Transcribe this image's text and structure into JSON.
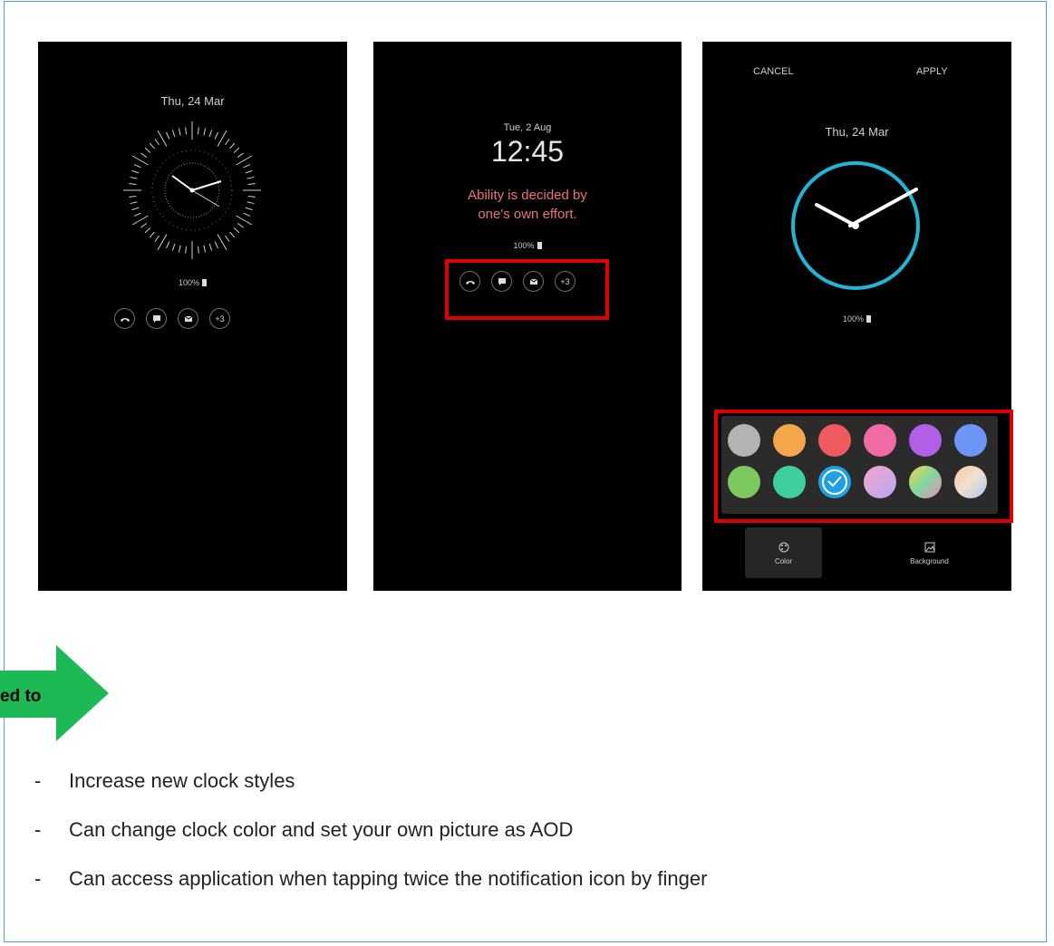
{
  "phone1": {
    "date": "Thu, 24 Mar",
    "battery": "100%",
    "notifications": [
      "missed-call-icon",
      "message-icon",
      "email-icon",
      "+3"
    ]
  },
  "phone2": {
    "date": "Tue, 2 Aug",
    "time": "12:45",
    "quote_line1": "Ability is decided by",
    "quote_line2": "one's own effort.",
    "battery": "100%",
    "notifications": [
      "missed-call-icon",
      "message-icon",
      "email-icon",
      "+3"
    ]
  },
  "phone3": {
    "cancel": "CANCEL",
    "apply": "APPLY",
    "date": "Thu, 24 Mar",
    "battery": "100%",
    "clock_color": "#1fb7d6",
    "swatches": [
      "#b3b3b3",
      "#f4a64a",
      "#ef5a5f",
      "#f06aa3",
      "#b05fe6",
      "#6c95f5",
      "#7dc95e",
      "#3fcf9f",
      "#1fa0e6",
      "gradient-pink",
      "gradient-yellow",
      "gradient-peach"
    ],
    "selected_swatch": 8,
    "tab_color": "Color",
    "tab_background": "Background"
  },
  "arrow": {
    "label": "ed to",
    "color": "#1db954"
  },
  "bullets": [
    "Increase new clock styles",
    "Can change clock color and set your own picture as AOD",
    "Can access application when tapping twice the notification icon by finger"
  ],
  "dash": "-"
}
